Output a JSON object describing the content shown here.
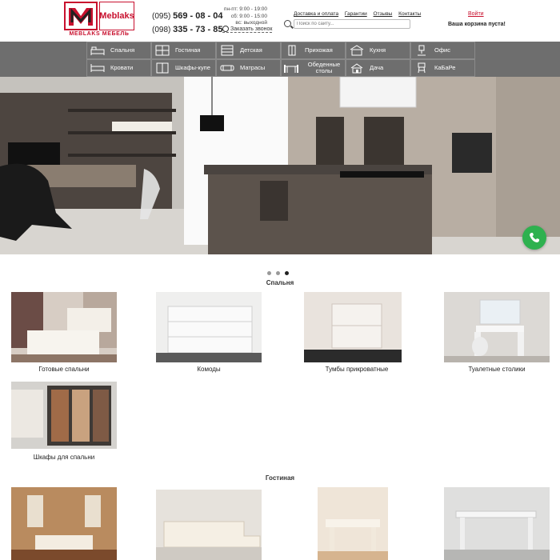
{
  "brand": {
    "name": "Meblaks",
    "subtitle": "MEBLAKS МЕБЕЛЬ",
    "color": "#c8102e"
  },
  "phones": [
    {
      "code": "(095)",
      "number": "569 - 08 - 04"
    },
    {
      "code": "(098)",
      "number": "335 - 73 - 85"
    }
  ],
  "hours": {
    "weekdays": "пн-пт: 9:00 - 19:00",
    "saturday": "сб: 9:00 - 15:00",
    "sunday": "вс: выходной"
  },
  "callback_label": "Заказать звонок",
  "top_links": [
    "Доставка и оплата",
    "Гарантии",
    "Отзывы",
    "Контакты"
  ],
  "search": {
    "placeholder": "Поиск по сайту..."
  },
  "login_label": "Войти",
  "cart_label": "Ваша корзина пуста!",
  "nav": [
    {
      "label": "Спальня",
      "icon": "bed-icon"
    },
    {
      "label": "Гостиная",
      "icon": "living-room-icon"
    },
    {
      "label": "Детская",
      "icon": "kids-room-icon"
    },
    {
      "label": "Прихожая",
      "icon": "hallway-icon"
    },
    {
      "label": "Кухня",
      "icon": "kitchen-icon"
    },
    {
      "label": "Офис",
      "icon": "office-chair-icon"
    },
    {
      "label": "Кровати",
      "icon": "bed-frame-icon"
    },
    {
      "label": "Шкафы-купе",
      "icon": "wardrobe-icon"
    },
    {
      "label": "Матрасы",
      "icon": "mattress-icon"
    },
    {
      "label": "Обеденные столы",
      "icon": "dining-table-icon"
    },
    {
      "label": "Дача",
      "icon": "country-house-icon"
    },
    {
      "label": "КаБаРе",
      "icon": "bar-chair-icon"
    }
  ],
  "slider": {
    "count": 3,
    "active": 2
  },
  "sections": [
    {
      "title": "Спальня",
      "items": [
        "Готовые спальни",
        "Комоды",
        "Тумбы прикроватные",
        "Туалетные столики",
        "Шкафы для спальни"
      ]
    },
    {
      "title": "Гостиная"
    }
  ],
  "colors": {
    "nav_bg": "#6e6e6e",
    "chat_green": "#2eb14f",
    "link_red": "#c8102e"
  }
}
